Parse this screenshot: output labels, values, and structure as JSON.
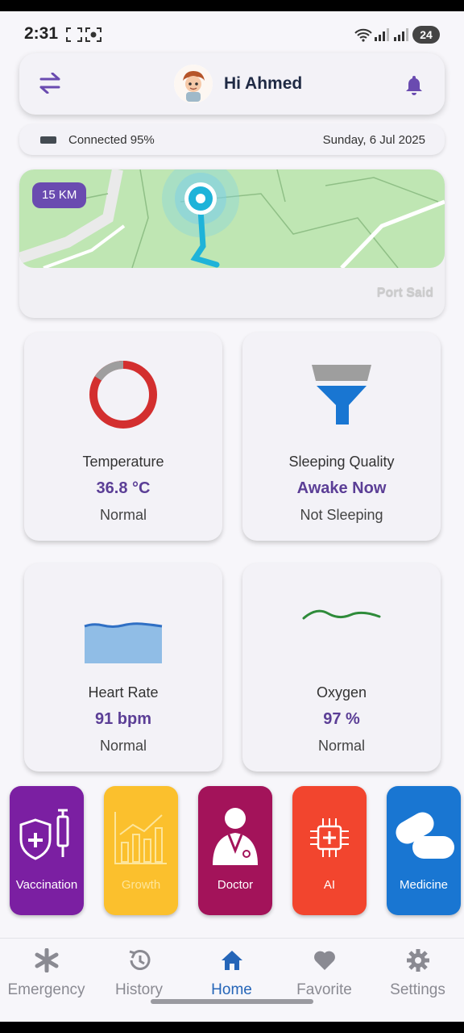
{
  "status_bar": {
    "time": "2:31",
    "battery": "24"
  },
  "header": {
    "greeting": "Hi Ahmed"
  },
  "connection": {
    "status": "Connected 95%",
    "date": "Sunday, 6 Jul 2025"
  },
  "map": {
    "distance": "15 KM",
    "city": "Port Said"
  },
  "tiles": [
    {
      "title": "Temperature",
      "value": "36.8 °C",
      "status": "Normal",
      "icon": "temperature-donut-icon"
    },
    {
      "title": "Sleeping Quality",
      "value": "Awake Now",
      "status": "Not Sleeping",
      "icon": "funnel-icon"
    },
    {
      "title": "Heart Rate",
      "value": "91 bpm",
      "status": "Normal",
      "icon": "wave-area-icon"
    },
    {
      "title": "Oxygen",
      "value": "97 %",
      "status": "Normal",
      "icon": "wave-line-icon"
    }
  ],
  "actions": [
    {
      "label": "Vaccination",
      "color": "#7b1fa2"
    },
    {
      "label": "Growth",
      "color": "#fbc02d"
    },
    {
      "label": "Doctor",
      "color": "#a3135a"
    },
    {
      "label": "AI",
      "color": "#f2452e"
    },
    {
      "label": "Medicine",
      "color": "#1976d2"
    }
  ],
  "nav": [
    {
      "label": "Emergency",
      "icon": "asterisk-icon"
    },
    {
      "label": "History",
      "icon": "history-icon"
    },
    {
      "label": "Home",
      "icon": "home-icon",
      "active": true
    },
    {
      "label": "Favorite",
      "icon": "heart-icon"
    },
    {
      "label": "Settings",
      "icon": "gear-icon"
    }
  ],
  "colors": {
    "accent": "#5b3e96",
    "nav_active": "#2565b8",
    "map_green": "#bfe6b3"
  }
}
